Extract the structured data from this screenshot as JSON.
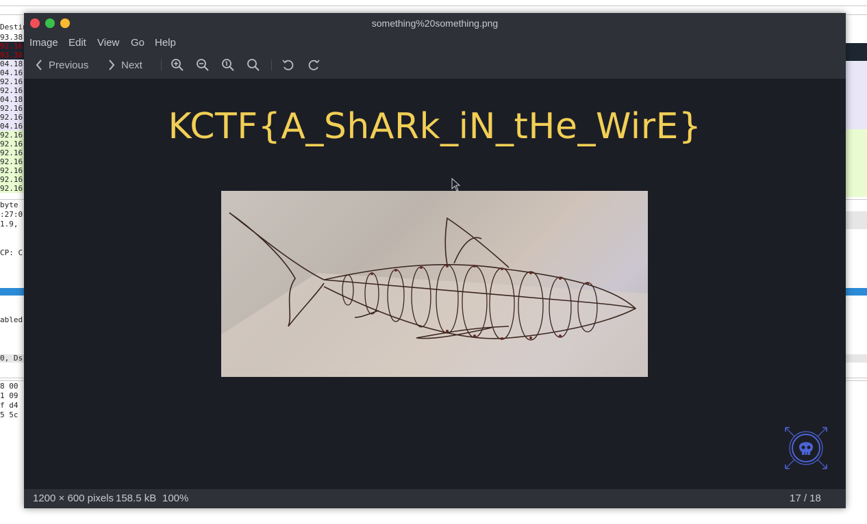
{
  "background_app": {
    "list_header": "Destina",
    "list_rows": [
      {
        "text": "93.38",
        "color": "#1f1f1f",
        "bg": "#ffffff"
      },
      {
        "text": "92.16",
        "color": "#c00000",
        "bg": "#1d2631"
      },
      {
        "text": "93.38",
        "color": "#c00000",
        "bg": "#1d2631"
      },
      {
        "text": "04.18",
        "color": "#1f1f1f",
        "bg": "#e8e6f7"
      },
      {
        "text": "04.16",
        "color": "#1f1f1f",
        "bg": "#e8e6f7"
      },
      {
        "text": "92.16",
        "color": "#1f1f1f",
        "bg": "#e8e6f7"
      },
      {
        "text": "92.16",
        "color": "#1f1f1f",
        "bg": "#e8e6f7"
      },
      {
        "text": "04.18",
        "color": "#1f1f1f",
        "bg": "#e8e6f7"
      },
      {
        "text": "92.16",
        "color": "#1f1f1f",
        "bg": "#e8e6f7"
      },
      {
        "text": "92.16",
        "color": "#1f1f1f",
        "bg": "#e8e6f7"
      },
      {
        "text": "04.16",
        "color": "#1f1f1f",
        "bg": "#e8e6f7"
      },
      {
        "text": "92.16",
        "color": "#1f1f1f",
        "bg": "#e8fcd0"
      },
      {
        "text": "92.16",
        "color": "#1f1f1f",
        "bg": "#e8fcd0"
      },
      {
        "text": "92.16",
        "color": "#1f1f1f",
        "bg": "#e8fcd0"
      },
      {
        "text": "92.16",
        "color": "#1f1f1f",
        "bg": "#e8fcd0"
      },
      {
        "text": "92.16",
        "color": "#1f1f1f",
        "bg": "#e8fcd0"
      },
      {
        "text": "92.16",
        "color": "#1f1f1f",
        "bg": "#e8fcd0"
      },
      {
        "text": "92.16",
        "color": "#1f1f1f",
        "bg": "#e8fcd0"
      }
    ],
    "detail_lines": [
      " byte",
      ":27:0",
      "1.9, ",
      "CP: C",
      "abled",
      "0, Ds"
    ],
    "hex_lines": [
      "8 00 ",
      "1 09 ",
      "f d4 ",
      "5 5c "
    ]
  },
  "viewer": {
    "window_title": "something%20something.png",
    "menu": [
      "Image",
      "Edit",
      "View",
      "Go",
      "Help"
    ],
    "toolbar": {
      "previous_label": "Previous",
      "next_label": "Next"
    },
    "image_text": "KCTF{A_ShARk_iN_tHe_WirE}",
    "status": {
      "dimensions": "1200 × 600 pixels",
      "size": "158.5 kB",
      "zoom": "100%",
      "position": "17 / 18"
    },
    "colors": {
      "flag_text": "#f2cf55",
      "window_bg": "#1c1e26",
      "chrome": "#2e3137",
      "logo": "#4c63d6"
    },
    "icons": [
      "chevron-left-icon",
      "chevron-right-icon",
      "zoom-in-icon",
      "zoom-out-icon",
      "zoom-original-icon",
      "zoom-fit-icon",
      "rotate-left-icon",
      "rotate-right-icon",
      "skull-logo-icon"
    ]
  }
}
